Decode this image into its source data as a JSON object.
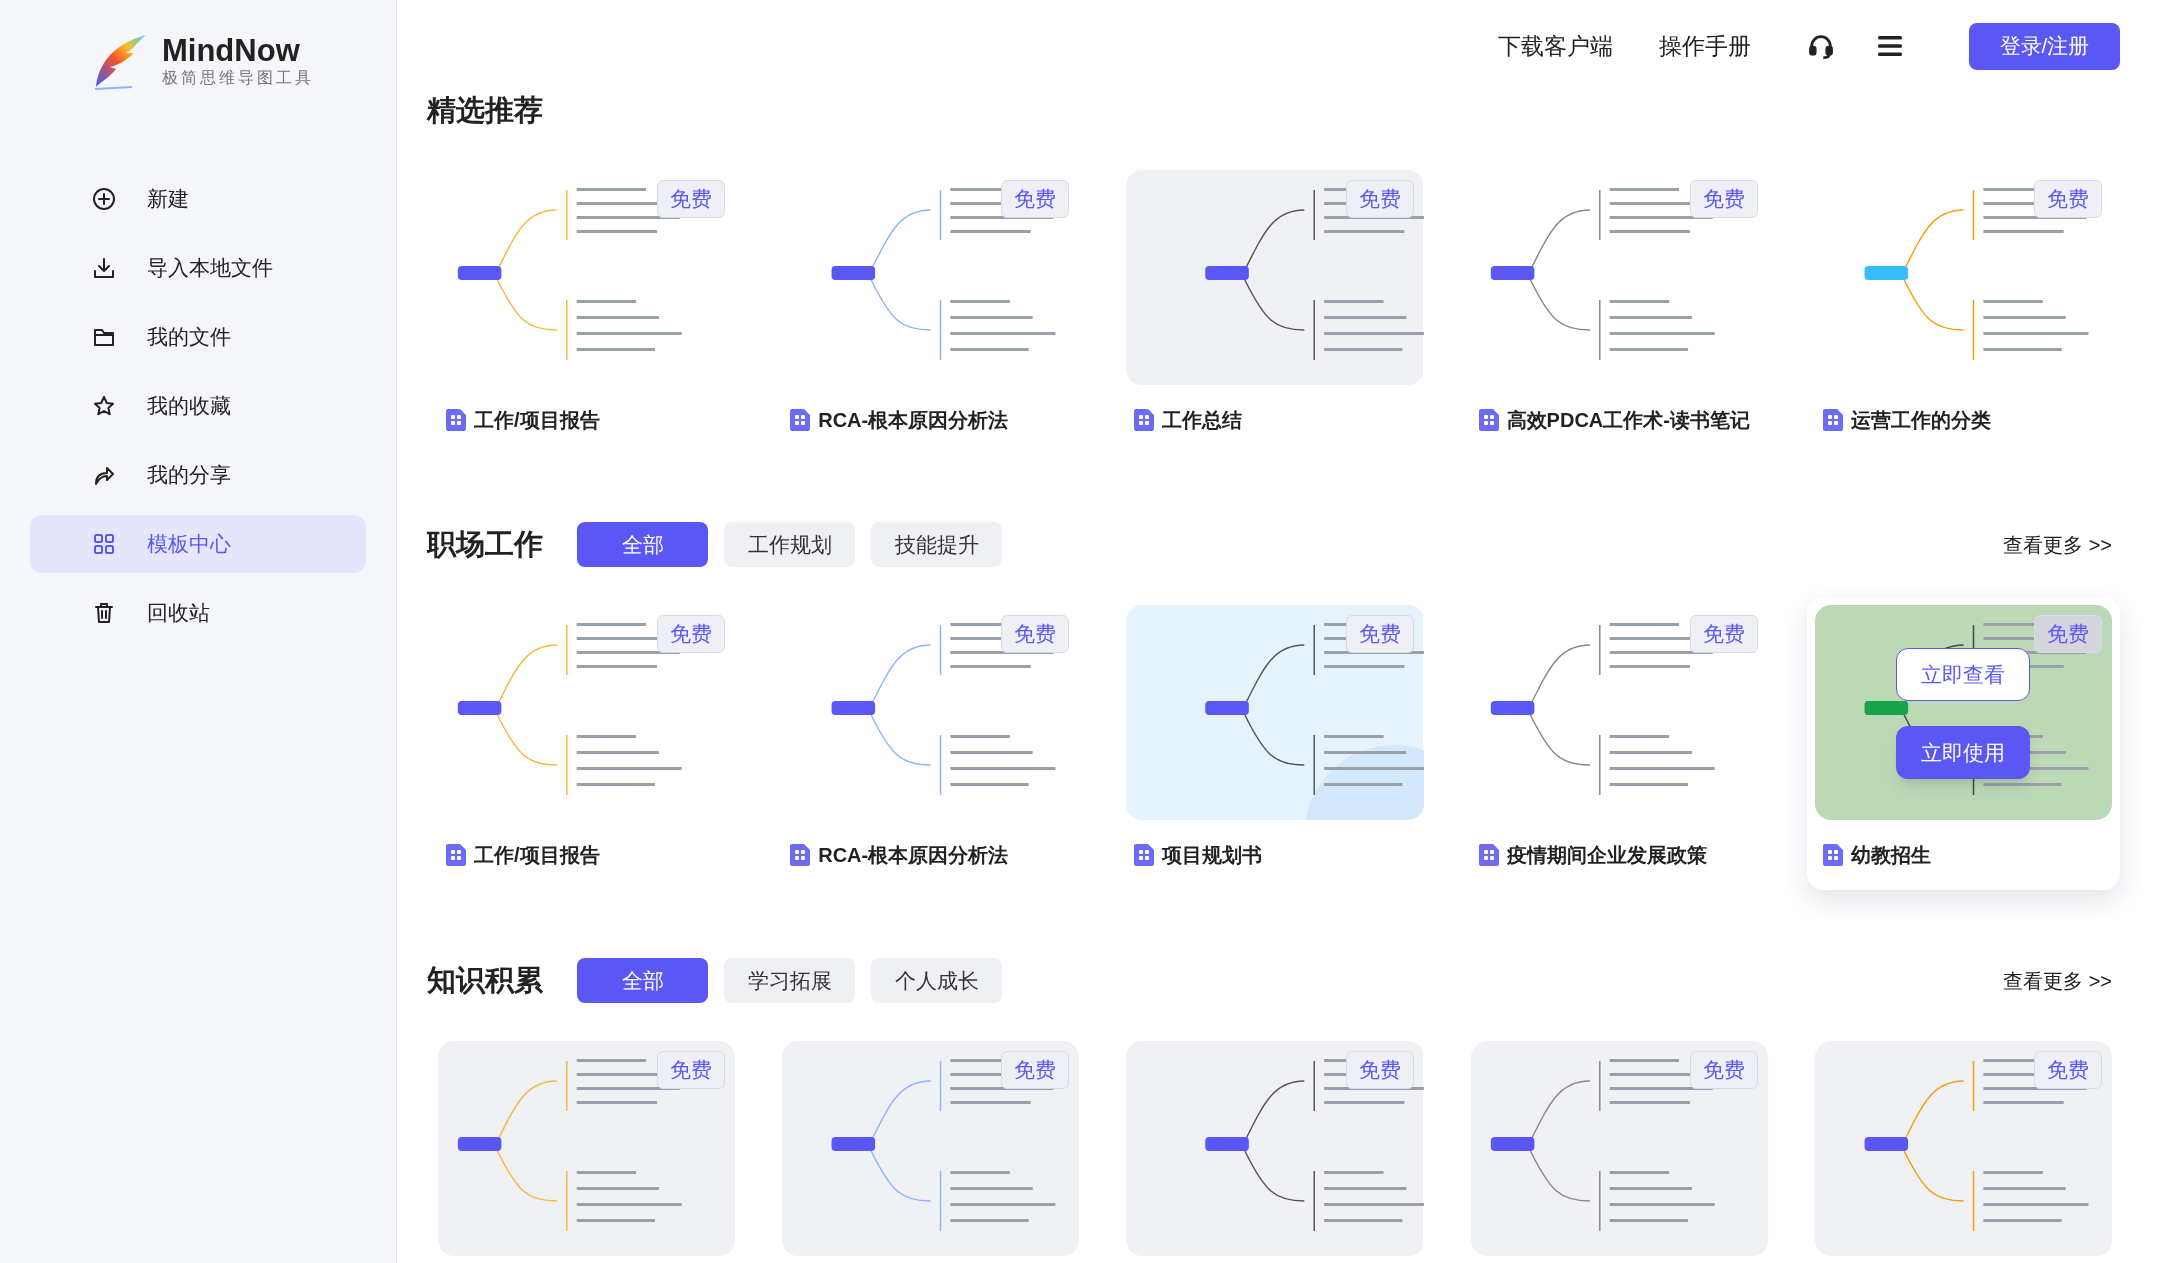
{
  "brand": {
    "name": "MindNow",
    "tagline": "极简思维导图工具"
  },
  "nav": [
    {
      "label": "新建",
      "selected": false
    },
    {
      "label": "导入本地文件",
      "selected": false
    },
    {
      "label": "我的文件",
      "selected": false
    },
    {
      "label": "我的收藏",
      "selected": false
    },
    {
      "label": "我的分享",
      "selected": false
    },
    {
      "label": "模板中心",
      "selected": true
    },
    {
      "label": "回收站",
      "selected": false
    }
  ],
  "header": {
    "links": [
      "下载客户端",
      "操作手册"
    ],
    "login": "登录/注册"
  },
  "featured": {
    "title": "精选推荐",
    "cards": [
      {
        "title": "工作/项目报告",
        "badge": "免费",
        "hovered": false
      },
      {
        "title": "RCA-根本原因分析法",
        "badge": "免费",
        "hovered": false
      },
      {
        "title": "工作总结",
        "badge": "免费",
        "hovered": false
      },
      {
        "title": "高效PDCA工作术-读书笔记",
        "badge": "免费",
        "hovered": false
      },
      {
        "title": "运营工作的分类",
        "badge": "免费",
        "hovered": false
      }
    ]
  },
  "sections": [
    {
      "title": "职场工作",
      "more": "查看更多 >>",
      "filters": [
        {
          "label": "全部",
          "selected": true
        },
        {
          "label": "工作规划",
          "selected": false
        },
        {
          "label": "技能提升",
          "selected": false
        }
      ],
      "cards": [
        {
          "title": "工作/项目报告",
          "badge": "免费",
          "hovered": false
        },
        {
          "title": "RCA-根本原因分析法",
          "badge": "免费",
          "hovered": false
        },
        {
          "title": "项目规划书",
          "badge": "免费",
          "hovered": false
        },
        {
          "title": "疫情期间企业发展政策",
          "badge": "免费",
          "hovered": false
        },
        {
          "title": "幼教招生",
          "badge": "免费",
          "hovered": true,
          "actions": [
            "立即查看",
            "立即使用"
          ]
        }
      ]
    },
    {
      "title": "知识积累",
      "more": "查看更多 >>",
      "filters": [
        {
          "label": "全部",
          "selected": true
        },
        {
          "label": "学习拓展",
          "selected": false
        },
        {
          "label": "个人成长",
          "selected": false
        }
      ],
      "cards": [
        {
          "badge": "免费",
          "hovered": false
        },
        {
          "badge": "免费",
          "hovered": false
        },
        {
          "badge": "免费",
          "hovered": false
        },
        {
          "badge": "免费",
          "hovered": false
        },
        {
          "badge": "免费",
          "hovered": false
        }
      ]
    }
  ]
}
